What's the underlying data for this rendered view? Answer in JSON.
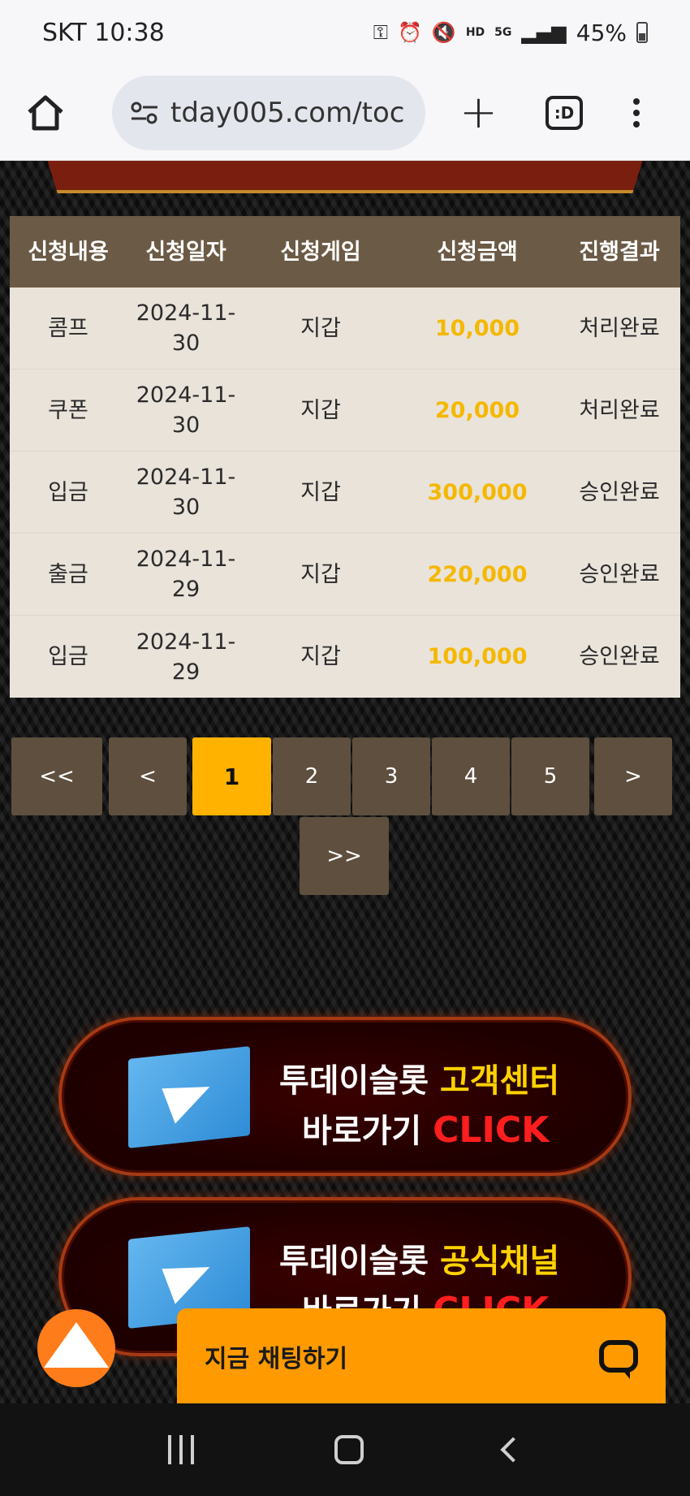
{
  "status_bar": {
    "carrier_time": "SKT 10:38",
    "battery": "45%",
    "icons": [
      "key-icon",
      "alarm-icon",
      "mute-icon",
      "hd-voice-icon",
      "5g-icon",
      "signal-icon",
      "battery-icon"
    ]
  },
  "browser": {
    "url": "tday005.com/toc",
    "tabs_label": ":D"
  },
  "table": {
    "headers": [
      "신청내용",
      "신청일자",
      "신청게임",
      "신청금액",
      "진행결과"
    ],
    "rows": [
      {
        "type": "콤프",
        "date": "2024-11-\n30",
        "game": "지갑",
        "amount": "10,000",
        "result": "처리완료"
      },
      {
        "type": "쿠폰",
        "date": "2024-11-\n30",
        "game": "지갑",
        "amount": "20,000",
        "result": "처리완료"
      },
      {
        "type": "입금",
        "date": "2024-11-\n30",
        "game": "지갑",
        "amount": "300,000",
        "result": "승인완료"
      },
      {
        "type": "출금",
        "date": "2024-11-\n29",
        "game": "지갑",
        "amount": "220,000",
        "result": "승인완료"
      },
      {
        "type": "입금",
        "date": "2024-11-\n29",
        "game": "지갑",
        "amount": "100,000",
        "result": "승인완료"
      }
    ]
  },
  "pagination": {
    "first": "<<",
    "prev": "<",
    "pages": [
      "1",
      "2",
      "3",
      "4",
      "5"
    ],
    "current": "1",
    "next": ">",
    "last": ">>"
  },
  "banners": [
    {
      "line1_prefix": "투데이슬롯 ",
      "line1_highlight": "고객센터",
      "line2_prefix": "바로가기 ",
      "line2_click": "CLICK"
    },
    {
      "line1_prefix": "투데이슬롯 ",
      "line1_highlight": "공식채널",
      "line2_prefix": "바로가기 ",
      "line2_click": "CLICK"
    }
  ],
  "chat": {
    "label": "지금 채팅하기"
  },
  "colors": {
    "accent": "#ffb300",
    "amount": "#f5b800",
    "table_header": "#6b5a45",
    "chat": "#ff9a00",
    "scroll_top": "#ff7c1a"
  }
}
